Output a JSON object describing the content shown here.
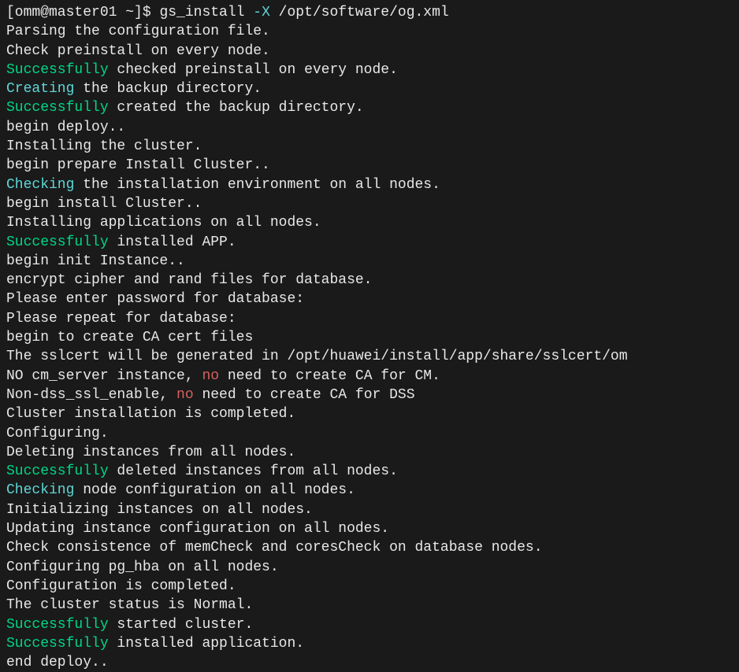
{
  "prompt": {
    "user_host": "[omm@master01 ~]$ ",
    "command": "gs_install ",
    "flag": "-X",
    "path": " /opt/software/og.xml"
  },
  "lines": {
    "l1": "Parsing the configuration file.",
    "l2": "Check preinstall on every node.",
    "l3a": "Successfully",
    "l3b": " checked preinstall on every node.",
    "l4a": "Creating",
    "l4b": " the backup directory.",
    "l5a": "Successfully",
    "l5b": " created the backup directory.",
    "l6": "begin deploy..",
    "l7": "Installing the cluster.",
    "l8": "begin prepare Install Cluster..",
    "l9a": "Checking",
    "l9b": " the installation environment on all nodes.",
    "l10": "begin install Cluster..",
    "l11": "Installing applications on all nodes.",
    "l12a": "Successfully",
    "l12b": " installed APP.",
    "l13": "begin init Instance..",
    "l14": "encrypt cipher and rand files for database.",
    "l15": "Please enter password for database:",
    "l16": "Please repeat for database:",
    "l17": "begin to create CA cert files",
    "l18": "The sslcert will be generated in /opt/huawei/install/app/share/sslcert/om",
    "l19a": "NO cm_server instance, ",
    "l19b": "no",
    "l19c": " need to create CA for CM.",
    "l20a": "Non-dss_ssl_enable, ",
    "l20b": "no",
    "l20c": " need to create CA for DSS",
    "l21": "Cluster installation is completed.",
    "l22": "Configuring.",
    "l23": "Deleting instances from all nodes.",
    "l24a": "Successfully",
    "l24b": " deleted instances from all nodes.",
    "l25a": "Checking",
    "l25b": " node configuration on all nodes.",
    "l26": "Initializing instances on all nodes.",
    "l27": "Updating instance configuration on all nodes.",
    "l28": "Check consistence of memCheck and coresCheck on database nodes.",
    "l29": "Configuring pg_hba on all nodes.",
    "l30": "Configuration is completed.",
    "l31": "The cluster status is Normal.",
    "l32a": "Successfully",
    "l32b": " started cluster.",
    "l33a": "Successfully",
    "l33b": " installed application.",
    "l34": "end deploy.."
  }
}
